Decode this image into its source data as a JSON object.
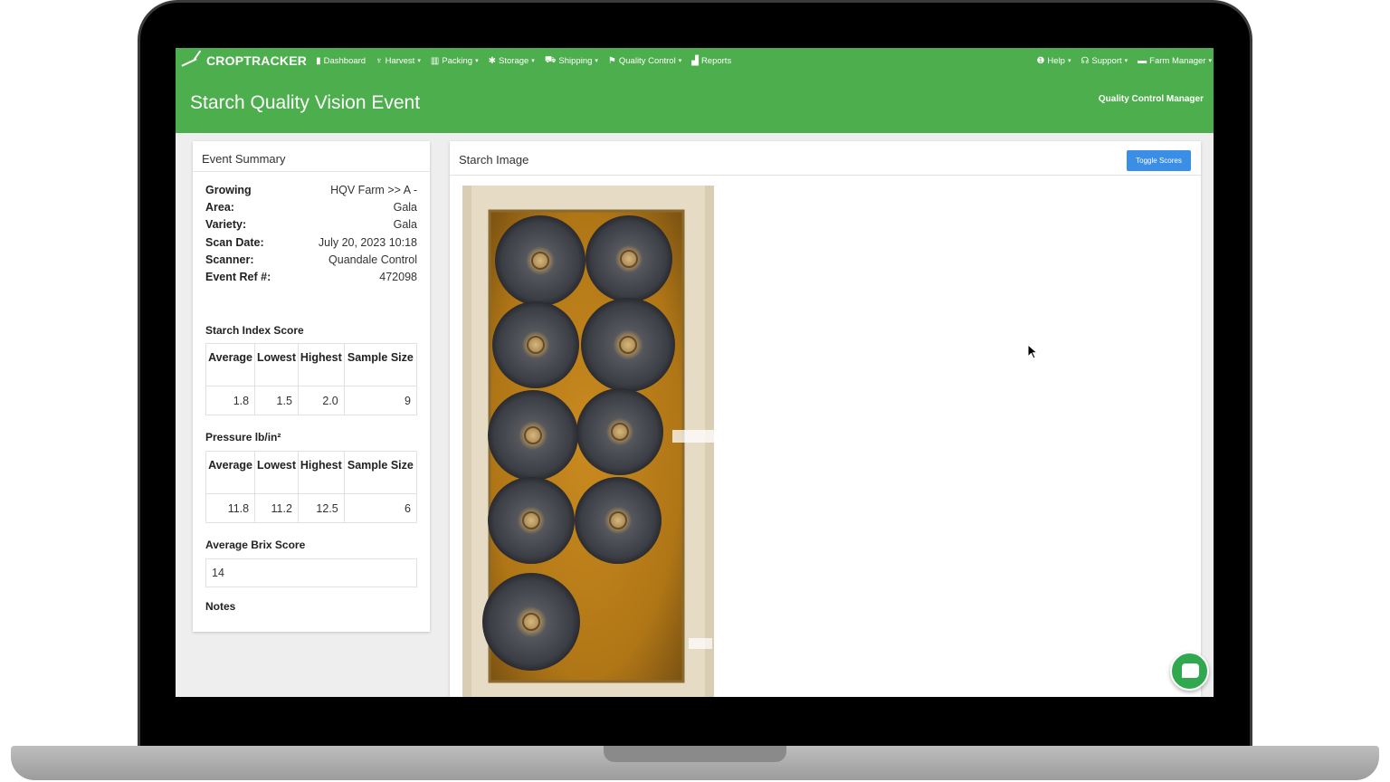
{
  "navbar": {
    "brand": "CROPTRACKER",
    "items": [
      {
        "label": "Dashboard",
        "icon": "bookmark-icon",
        "dropdown": false
      },
      {
        "label": "Harvest",
        "icon": "harvest-icon",
        "dropdown": true
      },
      {
        "label": "Packing",
        "icon": "packing-icon",
        "dropdown": true
      },
      {
        "label": "Storage",
        "icon": "gear-icon",
        "dropdown": true
      },
      {
        "label": "Shipping",
        "icon": "truck-icon",
        "dropdown": true
      },
      {
        "label": "Quality Control",
        "icon": "flag-icon",
        "dropdown": true
      },
      {
        "label": "Reports",
        "icon": "bar-chart-icon",
        "dropdown": false
      }
    ],
    "right": [
      {
        "label": "Help",
        "icon": "info-icon"
      },
      {
        "label": "Support",
        "icon": "headset-icon"
      },
      {
        "label": "Farm Manager",
        "icon": "briefcase-icon"
      }
    ],
    "caret": "▾"
  },
  "header": {
    "title": "Starch Quality Vision Event",
    "role": "Quality Control Manager"
  },
  "summary": {
    "heading": "Event Summary",
    "fields": [
      {
        "key": "Growing",
        "value": "HQV Farm >> A -"
      },
      {
        "key": "Area:",
        "value": "Gala"
      },
      {
        "key": "Variety:",
        "value": "Gala"
      },
      {
        "key": "Scan Date:",
        "value": "July 20, 2023 10:18"
      },
      {
        "key": "Scanner:",
        "value": "Quandale Control"
      },
      {
        "key": "Event Ref #:",
        "value": "472098"
      }
    ],
    "starch": {
      "label": "Starch Index Score",
      "headers": [
        "Average",
        "Lowest",
        "Highest",
        "Sample Size"
      ],
      "values": [
        "1.8",
        "1.5",
        "2.0",
        "9"
      ]
    },
    "pressure": {
      "label": "Pressure lb/in²",
      "headers": [
        "Average",
        "Lowest",
        "Highest",
        "Sample Size"
      ],
      "values": [
        "11.8",
        "11.2",
        "12.5",
        "6"
      ]
    },
    "brix": {
      "label": "Average Brix Score",
      "value": "14"
    },
    "notes_label": "Notes"
  },
  "image_panel": {
    "heading": "Starch Image",
    "toggle_label": "Toggle Scores"
  },
  "colors": {
    "brand_green": "#4cae4c",
    "button_blue": "#3a8ee6",
    "chat_green": "#2fa84f"
  }
}
